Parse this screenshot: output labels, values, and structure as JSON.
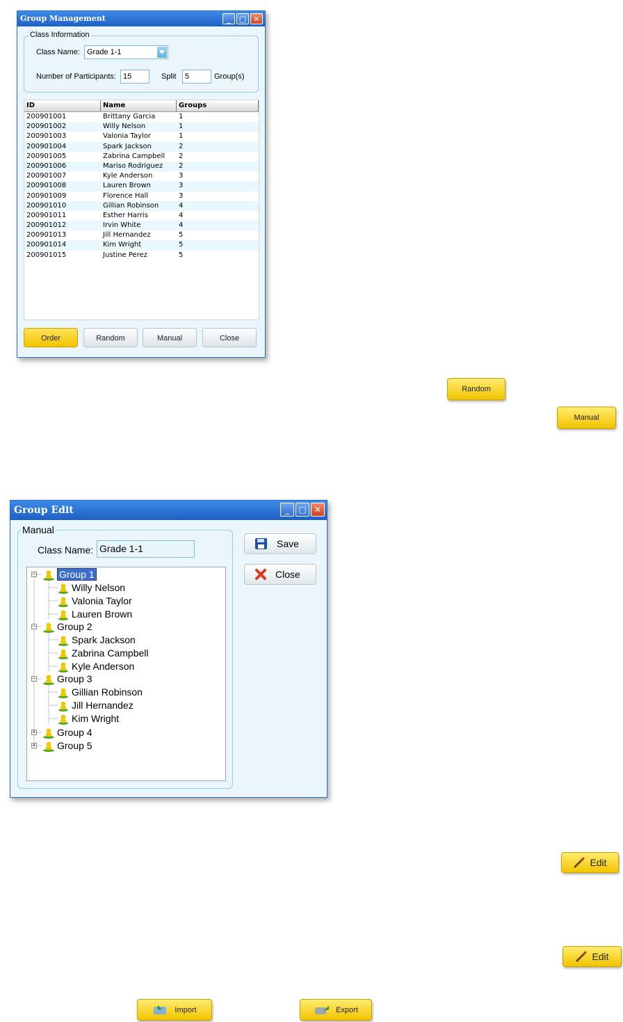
{
  "group_management": {
    "title": "Group Management",
    "class_info_legend": "Class Information",
    "class_name_label": "Class Name:",
    "class_name_value": "Grade 1-1",
    "participants_label": "Number of Participants:",
    "participants_value": "15",
    "split_label": "Split",
    "split_value": "5",
    "groups_suffix": "Group(s)",
    "columns": [
      "ID",
      "Name",
      "Groups"
    ],
    "rows": [
      [
        "200901001",
        "Brittany Garcia",
        "1"
      ],
      [
        "200901002",
        "Willy Nelson",
        "1"
      ],
      [
        "200901003",
        "Valonia Taylor",
        "1"
      ],
      [
        "200901004",
        "Spark Jackson",
        "2"
      ],
      [
        "200901005",
        "Zabrina Campbell",
        "2"
      ],
      [
        "200901006",
        "Mariso Rodriguez",
        "2"
      ],
      [
        "200901007",
        "Kyle Anderson",
        "3"
      ],
      [
        "200901008",
        "Lauren Brown",
        "3"
      ],
      [
        "200901009",
        "Florence Hall",
        "3"
      ],
      [
        "200901010",
        "Gillian Robinson",
        "4"
      ],
      [
        "200901011",
        "Esther Harris",
        "4"
      ],
      [
        "200901012",
        "Irvin White",
        "4"
      ],
      [
        "200901013",
        "Jill Hernandez",
        "5"
      ],
      [
        "200901014",
        "Kim Wright",
        "5"
      ],
      [
        "200901015",
        "Justine Perez",
        "5"
      ]
    ],
    "buttons": {
      "order": "Order",
      "random": "Random",
      "manual": "Manual",
      "close": "Close"
    }
  },
  "standalone_buttons": {
    "random": "Random",
    "manual": "Manual",
    "edit_1": "Edit",
    "edit_2": "Edit",
    "import": "Import",
    "export": "Export"
  },
  "group_edit": {
    "title": "Group Edit",
    "legend": "Manual",
    "class_name_label": "Class Name:",
    "class_name_value": "Grade 1-1",
    "save_label": "Save",
    "close_label": "Close",
    "tree": {
      "group1": "Group 1",
      "group1_members": [
        "Willy Nelson",
        "Valonia Taylor",
        "Lauren Brown"
      ],
      "group2": "Group 2",
      "group2_members": [
        "Spark Jackson",
        "Zabrina Campbell",
        "Kyle Anderson"
      ],
      "group3": "Group 3",
      "group3_members": [
        "Gillian Robinson",
        "Jill Hernandez",
        "Kim Wright"
      ],
      "group4": "Group 4",
      "group5": "Group 5"
    }
  },
  "colors": {
    "title_bar": "#1f5fc4",
    "accent_yellow": "#f3c300",
    "panel_bg": "#eaf6fb",
    "selection": "#3a6fd0"
  }
}
